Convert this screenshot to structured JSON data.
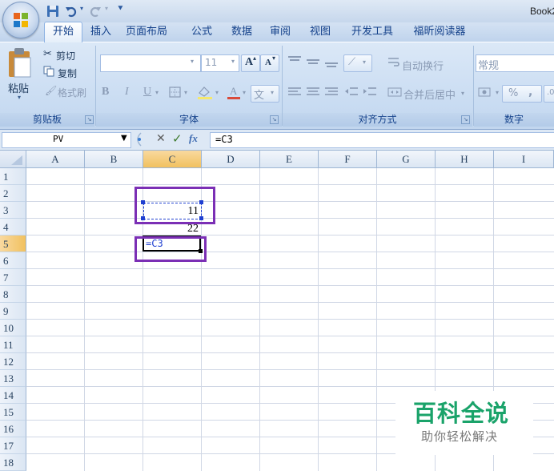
{
  "window": {
    "title": "Book2",
    "quick_access": [
      "save-icon",
      "undo-icon",
      "redo-icon",
      "customize-qat-icon"
    ]
  },
  "tabs": [
    {
      "label": "开始",
      "active": true
    },
    {
      "label": "插入"
    },
    {
      "label": "页面布局"
    },
    {
      "label": "公式"
    },
    {
      "label": "数据"
    },
    {
      "label": "审阅"
    },
    {
      "label": "视图"
    },
    {
      "label": "开发工具"
    },
    {
      "label": "福昕阅读器"
    }
  ],
  "ribbon": {
    "clipboard": {
      "label": "剪贴板",
      "paste": "粘贴",
      "cut": "剪切",
      "copy": "复制",
      "format_painter": "格式刷"
    },
    "font": {
      "label": "字体",
      "font_name": "",
      "font_size": "11",
      "bold": "B",
      "italic": "I",
      "underline": "U",
      "grow": "A",
      "shrink": "A",
      "phonetic": "文"
    },
    "alignment": {
      "label": "对齐方式",
      "wrap_text": "自动换行",
      "merge_center": "合并后居中"
    },
    "number": {
      "label": "数字",
      "format": "常规",
      "percent": "%",
      "comma": ","
    }
  },
  "formula_bar": {
    "name_box": "PV",
    "cancel": "✕",
    "enter": "✓",
    "fx": "fx",
    "content": "=C3"
  },
  "grid": {
    "columns": [
      "A",
      "B",
      "C",
      "D",
      "E",
      "F",
      "G",
      "H",
      "I"
    ],
    "selected_column": "C",
    "rows": [
      "1",
      "2",
      "3",
      "4",
      "5",
      "6",
      "7",
      "8",
      "9",
      "10",
      "11",
      "12",
      "13",
      "14",
      "15",
      "16",
      "17",
      "18"
    ],
    "selected_row": "5",
    "cells": {
      "C3": "11",
      "C4": "22",
      "C5": "=C3"
    }
  },
  "watermark": {
    "title": "百科全说",
    "subtitle": "助你轻松解决"
  },
  "colors": {
    "highlight_box": "#7b2fb5",
    "header_selected": "#f5c86c",
    "watermark_green": "#1aa36a",
    "formula_ref_blue": "#1f3fd1"
  }
}
